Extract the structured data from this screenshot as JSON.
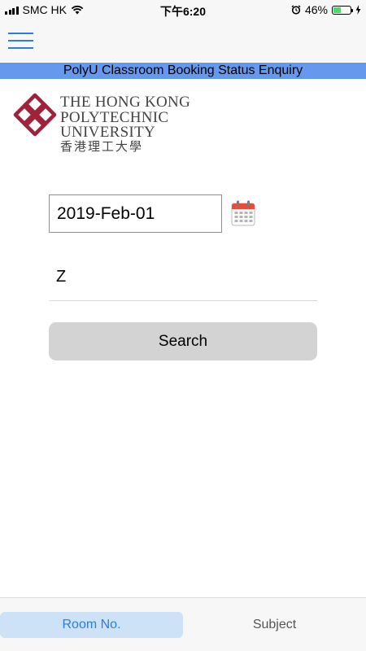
{
  "status_bar": {
    "carrier": "SMC HK",
    "time": "下午6:20",
    "battery_percent": "46%",
    "battery_level": 0.46,
    "battery_color": "#4cd964",
    "icons": [
      "signal-icon",
      "wifi-icon",
      "alarm-icon",
      "battery-icon",
      "charging-icon"
    ]
  },
  "nav": {
    "menu_icon": "hamburger-menu-icon",
    "accent_color": "#2a7de1"
  },
  "banner": {
    "title": "PolyU Classroom Booking Status Enquiry",
    "color": "#6699ee"
  },
  "logo": {
    "line1": "THE HONG KONG",
    "line2": "POLYTECHNIC UNIVERSITY",
    "line3": "香港理工大學",
    "emblem_color": "#a1213a"
  },
  "form": {
    "date_value": "2019-Feb-01",
    "calendar_icon": "calendar-icon",
    "subject_value": "Z",
    "search_label": "Search"
  },
  "tabs": [
    {
      "label": "Room No.",
      "selected": true
    },
    {
      "label": "Subject",
      "selected": false
    }
  ]
}
